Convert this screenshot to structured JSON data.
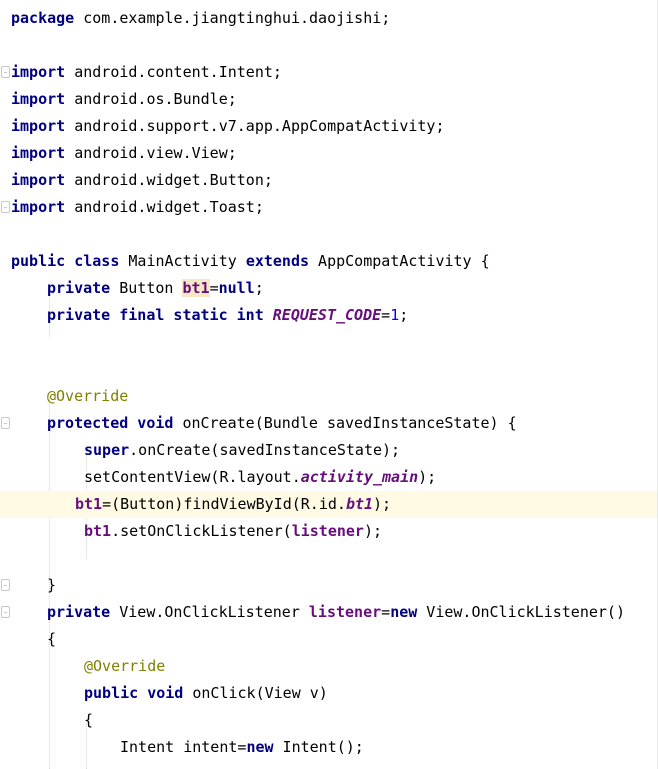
{
  "editor": {
    "package_line": {
      "kw": "package",
      "name": " com.example.jiangtinghui.daojishi;"
    },
    "imports": [
      {
        "kw": "import",
        "name": " android.content.Intent;"
      },
      {
        "kw": "import",
        "name": " android.os.Bundle;"
      },
      {
        "kw": "import",
        "name": " android.support.v7.app.AppCompatActivity;"
      },
      {
        "kw": "import",
        "name": " android.view.View;"
      },
      {
        "kw": "import",
        "name": " android.widget.Button;"
      },
      {
        "kw": "import",
        "name": " android.widget.Toast;"
      }
    ],
    "class_decl": {
      "kw1": "public class",
      "name": " MainActivity ",
      "kw2": "extends",
      "rest": " AppCompatActivity {"
    },
    "field1": {
      "kw": "private",
      "type": " Button ",
      "field": "bt1",
      "op": "=",
      "value": "null",
      "end": ";"
    },
    "field2": {
      "kw": "private final static int",
      "sp": " ",
      "field": "REQUEST_CODE",
      "op": "=",
      "value": "1",
      "end": ";"
    },
    "override1": "@Override",
    "oncreate_decl": {
      "kw": "protected void",
      "rest": " onCreate(Bundle savedInstanceState) {"
    },
    "super_call": {
      "kw": "super",
      "rest": ".onCreate(savedInstanceState);"
    },
    "set_content": {
      "pre": "setContentView(R.layout.",
      "field": "activity_main",
      "post": ");"
    },
    "find_view": {
      "field": "bt1",
      "pre": "=(Button)findViewById(R.id.",
      "idfield": "bt1",
      "post": ");"
    },
    "set_listener": {
      "field": "bt1",
      "pre": ".setOnClickListener(",
      "arg": "listener",
      "post": ");"
    },
    "close_brace": "}",
    "listener_decl": {
      "kw": "private",
      "type": " View.OnClickListener ",
      "field": "listener",
      "op": "=",
      "kw2": "new",
      "rest": " View.OnClickListener()"
    },
    "open_brace": "{",
    "override2": "@Override",
    "onclick_decl": {
      "kw": "public void",
      "rest": " onClick(View v)"
    },
    "open_brace2": "{",
    "intent_line": {
      "pre": "Intent intent=",
      "kw": "new",
      "post": " Intent();"
    }
  },
  "colors": {
    "keyword": "#000080",
    "annotation": "#808000",
    "field": "#660e7a",
    "number": "#0000ff",
    "caret_line": "#fffae3"
  }
}
